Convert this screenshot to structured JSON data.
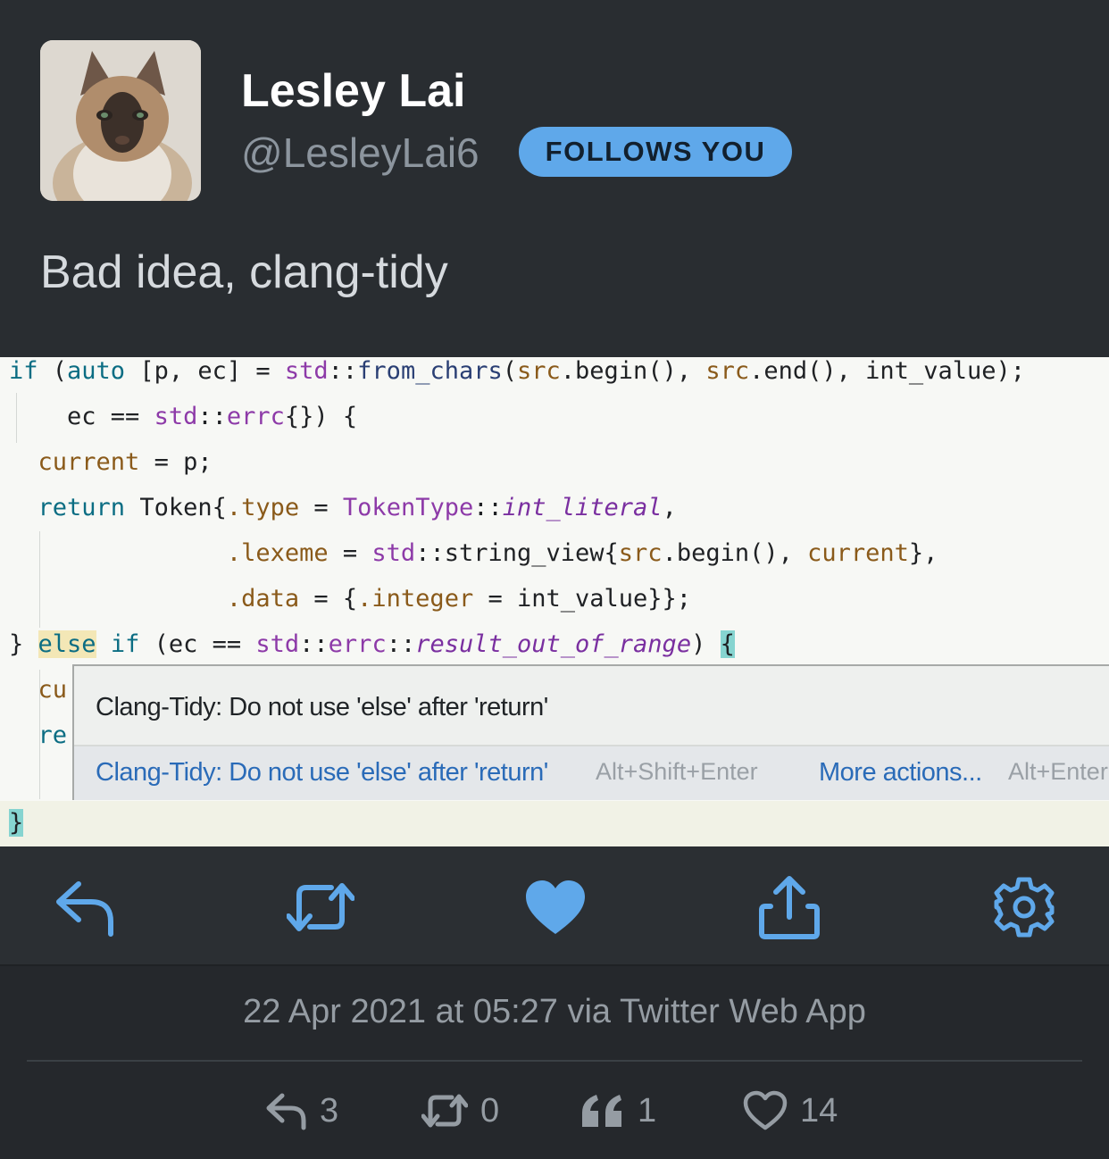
{
  "user": {
    "name": "Lesley Lai",
    "handle": "@LesleyLai6",
    "follows_badge": "FOLLOWS YOU"
  },
  "tweet": {
    "text": "Bad idea, clang-tidy"
  },
  "code_lines": [
    "if (auto [p, ec] = std::from_chars(src.begin(), src.end(), int_value);",
    "    ec == std::errc{}) {",
    "  current = p;",
    "  return Token{.type = TokenType::int_literal,",
    "               .lexeme = std::string_view{src.begin(), current},",
    "               .data = {.integer = int_value}};",
    "} else if (ec == std::errc::result_out_of_range) {",
    "  cu",
    "  re",
    "}"
  ],
  "tooltip": {
    "title": "Clang-Tidy: Do not use 'else' after 'return'",
    "action": "Clang-Tidy: Do not use 'else' after 'return'",
    "action_shortcut": "Alt+Shift+Enter",
    "more": "More actions...",
    "more_shortcut": "Alt+Enter"
  },
  "actions": {
    "reply": "reply-icon",
    "retweet": "retweet-icon",
    "like": "heart-icon",
    "share": "share-icon",
    "settings": "gear-icon",
    "accent_color": "#5fa8ea"
  },
  "meta": {
    "timestamp": "22 Apr 2021 at 05:27 via Twitter Web App"
  },
  "stats": {
    "replies": "3",
    "retweets": "0",
    "quotes": "1",
    "likes": "14"
  }
}
